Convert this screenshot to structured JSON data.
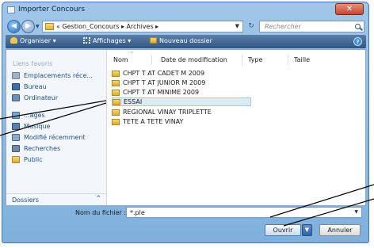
{
  "window": {
    "title": "Importer Concours",
    "close_glyph": "✕"
  },
  "address": {
    "path": "« Gestion_Concours ▸ Archives ▸",
    "search_placeholder": "Rechercher"
  },
  "toolbar": {
    "organize_label": "Organiser ▾",
    "views_label": "Affichages ▾",
    "new_folder_label": "Nouveau dossier"
  },
  "sidebar": {
    "heading": "Liens favoris",
    "items": [
      {
        "label": "Emplacements réce...",
        "icon": "recent-places-icon"
      },
      {
        "label": "Bureau",
        "icon": "desktop-icon"
      },
      {
        "label": "Ordinateur",
        "icon": "computer-icon"
      },
      {
        "label": "...ages",
        "icon": "pictures-icon"
      },
      {
        "label": "Musique",
        "icon": "music-icon"
      },
      {
        "label": "Modifié récemment",
        "icon": "recently-changed-icon"
      },
      {
        "label": "Recherches",
        "icon": "searches-icon"
      },
      {
        "label": "Public",
        "icon": "public-folder-icon"
      }
    ],
    "folders_label": "Dossiers",
    "folders_chevron": "⌃"
  },
  "file_list": {
    "columns": [
      "Nom",
      "Date de modification",
      "Type",
      "Taille"
    ],
    "sort_indicator": "^",
    "rows": [
      {
        "name": "CHPT T AT CADET M 2009",
        "selected": false
      },
      {
        "name": "CHPT T AT JUNIOR M 2009",
        "selected": false
      },
      {
        "name": "CHPT T AT MINIME 2009",
        "selected": false
      },
      {
        "name": "ESSAI",
        "selected": true
      },
      {
        "name": "REGIONAL VINAY TRIPLETTE",
        "selected": false
      },
      {
        "name": "TETE A TETE VINAY",
        "selected": false
      }
    ]
  },
  "bottom": {
    "filename_label": "Nom du fichier :",
    "filename_value": "*.ple",
    "open_label": "Ouvrir",
    "cancel_label": "Annuler"
  },
  "colors": {
    "frame": "#8fbbe3",
    "toolbar": "#3b6290",
    "selection": "#dcebfb",
    "link_text": "#1d4f86"
  }
}
